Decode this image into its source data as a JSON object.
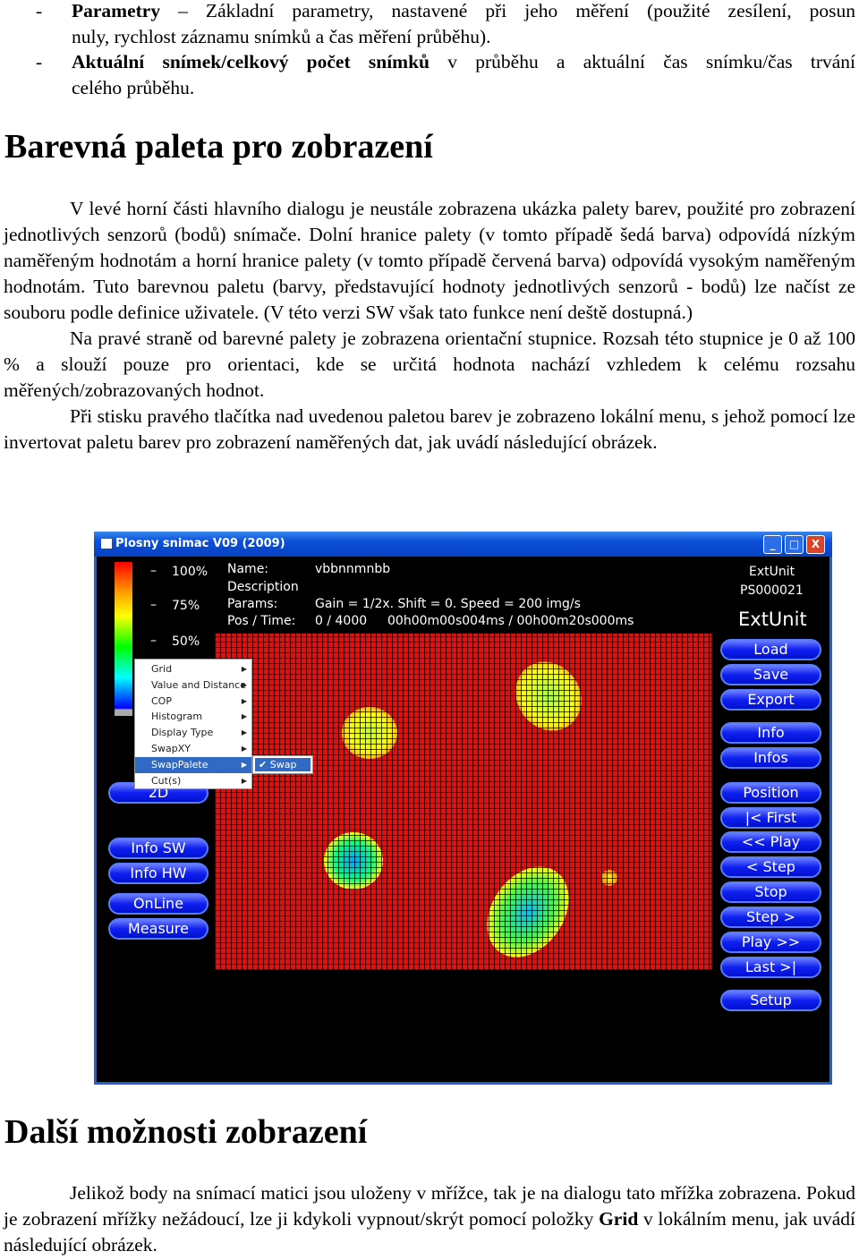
{
  "bullets": [
    {
      "bold": "Parametry",
      "lines": [
        "– Základní parametry, nastavené při jeho měření (použité zesílení, posun",
        "nuly, rychlost záznamu snímků a čas měření průběhu)."
      ]
    },
    {
      "bold": "Aktuální snímek/celkový počet snímků",
      "lines": [
        "v průběhu a aktuální čas snímku/čas trvání",
        "celého průběhu."
      ]
    }
  ],
  "section1": {
    "heading": "Barevná paleta pro zobrazení",
    "paragraphs": [
      "V levé horní části hlavního dialogu je neustále zobrazena ukázka palety barev, použité pro zobrazení jednotlivých senzorů (bodů) snímače. Dolní hranice palety (v tomto případě šedá barva) odpovídá nízkým naměřeným hodnotám a horní hranice palety (v tomto případě červená barva) odpovídá vysokým naměřeným hodnotám. Tuto barevnou paletu (barvy, představující hodnoty jednotlivých senzorů - bodů) lze načíst ze souboru podle definice uživatele. (V této verzi SW však tato funkce není deště dostupná.)",
      "Na pravé straně od barevné palety je zobrazena orientační stupnice. Rozsah této stupnice je 0 až 100 % a slouží pouze pro orientaci, kde se určitá hodnota nachází vzhledem k celému rozsahu měřených/zobrazovaných hodnot.",
      "Při stisku pravého tlačítka nad uvedenou paletou barev je zobrazeno lokální menu, s jehož pomocí lze invertovat paletu barev pro zobrazení naměřených dat, jak uvádí následující obrázek."
    ]
  },
  "app": {
    "title": "Plosny snimac V09 (2009)",
    "window_buttons": [
      "_",
      "□",
      "X"
    ],
    "scale": [
      "100%",
      "75%",
      "50%"
    ],
    "info": {
      "name_label": "Name:",
      "name": "vbbnnmnbb",
      "desc_label": "Description",
      "params_label": "Params:",
      "params": "Gain = 1/2x. Shift = 0. Speed = 200 img/s",
      "pos_label": "Pos / Time:",
      "pos": "0 / 4000",
      "time": "00h00m00s004ms / 00h00m20s000ms"
    },
    "ext": {
      "unit_small": "ExtUnit",
      "serial": "PS000021",
      "unit_big": "ExtUnit"
    },
    "left_buttons": [
      "2D",
      "Info SW",
      "Info HW",
      "OnLine",
      "Measure"
    ],
    "right_buttons": [
      "Load",
      "Save",
      "Export",
      "Info",
      "Infos",
      "Position",
      "|< First",
      "<< Play",
      "< Step",
      "Stop",
      "Step >",
      "Play >>",
      "Last >|",
      "Setup"
    ],
    "menu": [
      "Grid",
      "Value and Distance",
      "COP",
      "Histogram",
      "Display Type",
      "SwapXY",
      "SwapPalete",
      "Cut(s)"
    ],
    "menu_selected": "SwapPalete",
    "submenu": {
      "check": "✔",
      "label": "Swap"
    },
    "colors": {
      "titlebar": "#0a4fd8",
      "grid": "#e01010",
      "button": "#1020f0"
    }
  },
  "section2": {
    "heading": "Další možnosti zobrazení",
    "paragraph_parts": [
      "Jelikož body na snímací matici jsou uloženy v mřížce, tak je na dialogu tato mřížka zobrazena. Pokud je zobrazení mřížky nežádoucí, lze ji kdykoli vypnout/skrýt pomocí položky ",
      "Grid",
      " v lokálním menu, jak uvádí následující obrázek."
    ]
  }
}
